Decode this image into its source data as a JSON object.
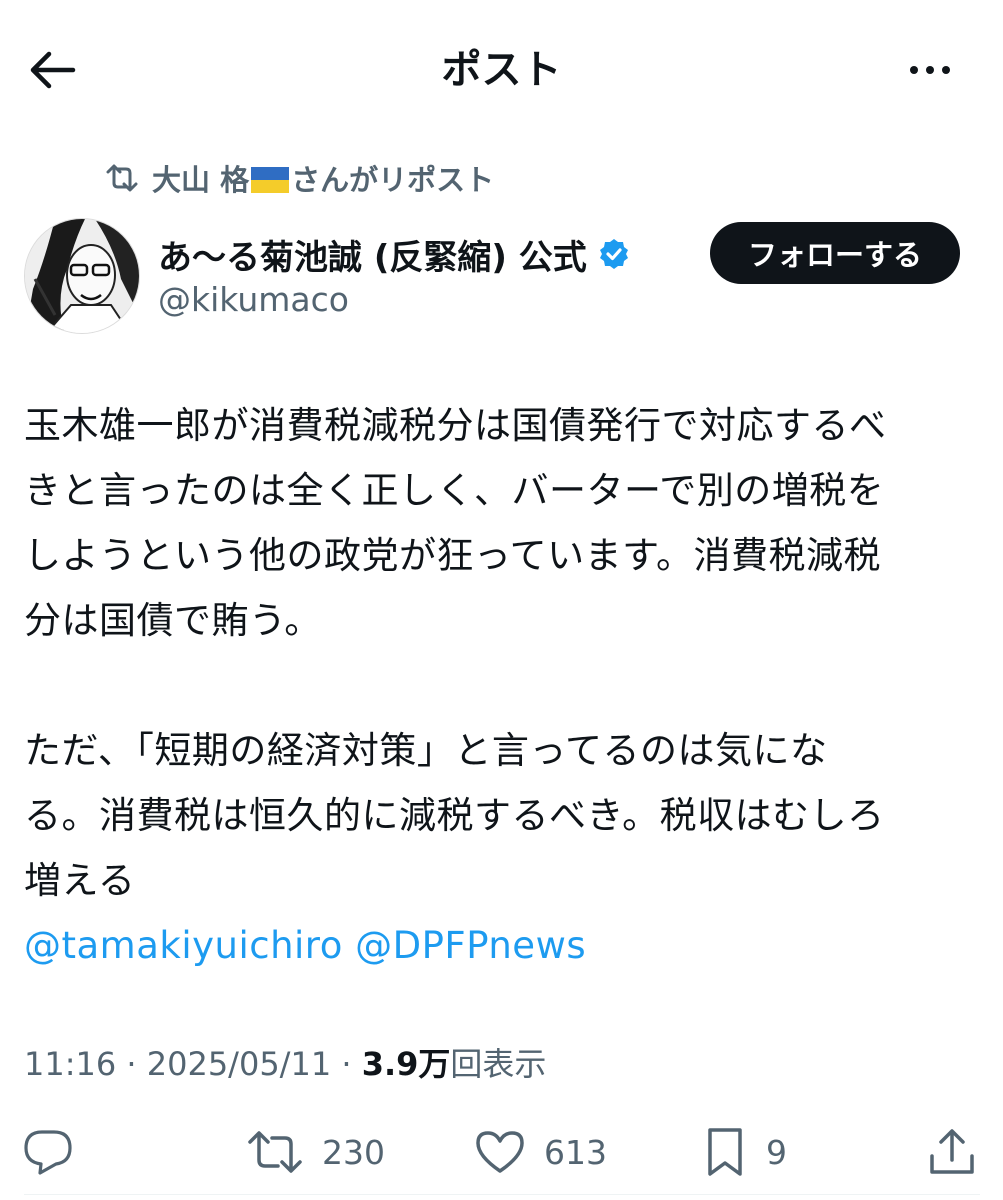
{
  "header": {
    "title": "ポスト"
  },
  "repost": {
    "user": "大山 格",
    "suffix": "さんがリポスト"
  },
  "author": {
    "name": "あ〜る菊池誠 (反緊縮) 公式",
    "handle": "@kikumaco",
    "verified": true
  },
  "follow_button": {
    "label": "フォローする"
  },
  "tweet": {
    "paragraph1": [
      "玉木雄一郎が消費税減税分は国債発行で対応するべ",
      "きと言ったのは全く正しく、バーターで別の増税を",
      "しようという他の政党が狂っています。消費税減税",
      "分は国債で賄う。"
    ],
    "paragraph2": [
      "ただ、「短期の経済対策」と言ってるのは気にな",
      "る。消費税は恒久的に減税するべき。税収はむしろ",
      "増える"
    ],
    "mentions": [
      "@tamakiyuichiro",
      "@DPFPnews"
    ]
  },
  "meta": {
    "time": "11:16",
    "date": "2025/05/11",
    "views": "3.9万",
    "views_suffix": "回表示"
  },
  "actions": {
    "retweets": "230",
    "likes": "613",
    "bookmarks": "9"
  },
  "colors": {
    "accent": "#1d9bf0",
    "text": "#0f1419",
    "muted": "#536471",
    "verified": "#1d9bf0"
  },
  "icons": [
    "back-arrow-icon",
    "more-icon",
    "repost-icon",
    "verified-badge-icon",
    "reply-icon",
    "retweet-icon",
    "like-icon",
    "bookmark-icon",
    "share-icon"
  ]
}
